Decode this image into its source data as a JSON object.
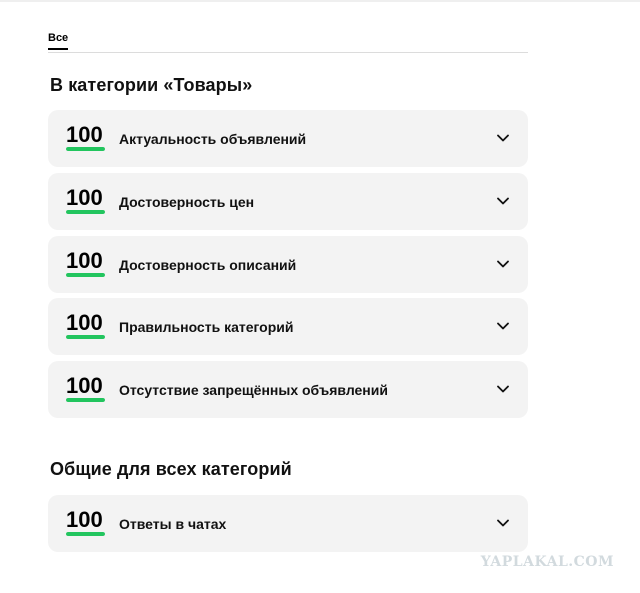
{
  "tabs": [
    {
      "label": "Все",
      "active": true
    }
  ],
  "sections": [
    {
      "title": "В категории «Товары»",
      "items": [
        {
          "score": "100",
          "label": "Актуальность объявлений",
          "progress": 1.0
        },
        {
          "score": "100",
          "label": "Достоверность цен",
          "progress": 1.0
        },
        {
          "score": "100",
          "label": "Достоверность описаний",
          "progress": 1.0
        },
        {
          "score": "100",
          "label": "Правильность категорий",
          "progress": 1.0
        },
        {
          "score": "100",
          "label": "Отсутствие запрещённых объявлений",
          "progress": 1.0
        }
      ]
    },
    {
      "title": "Общие для всех категорий",
      "items": [
        {
          "score": "100",
          "label": "Ответы в чатах",
          "progress": 1.0
        }
      ]
    }
  ],
  "colors": {
    "accent_green": "#22c55e",
    "card_background": "#f3f3f3"
  },
  "icons": {
    "expand": "chevron-down-icon"
  },
  "watermark": "YAPLAKAL.COM"
}
